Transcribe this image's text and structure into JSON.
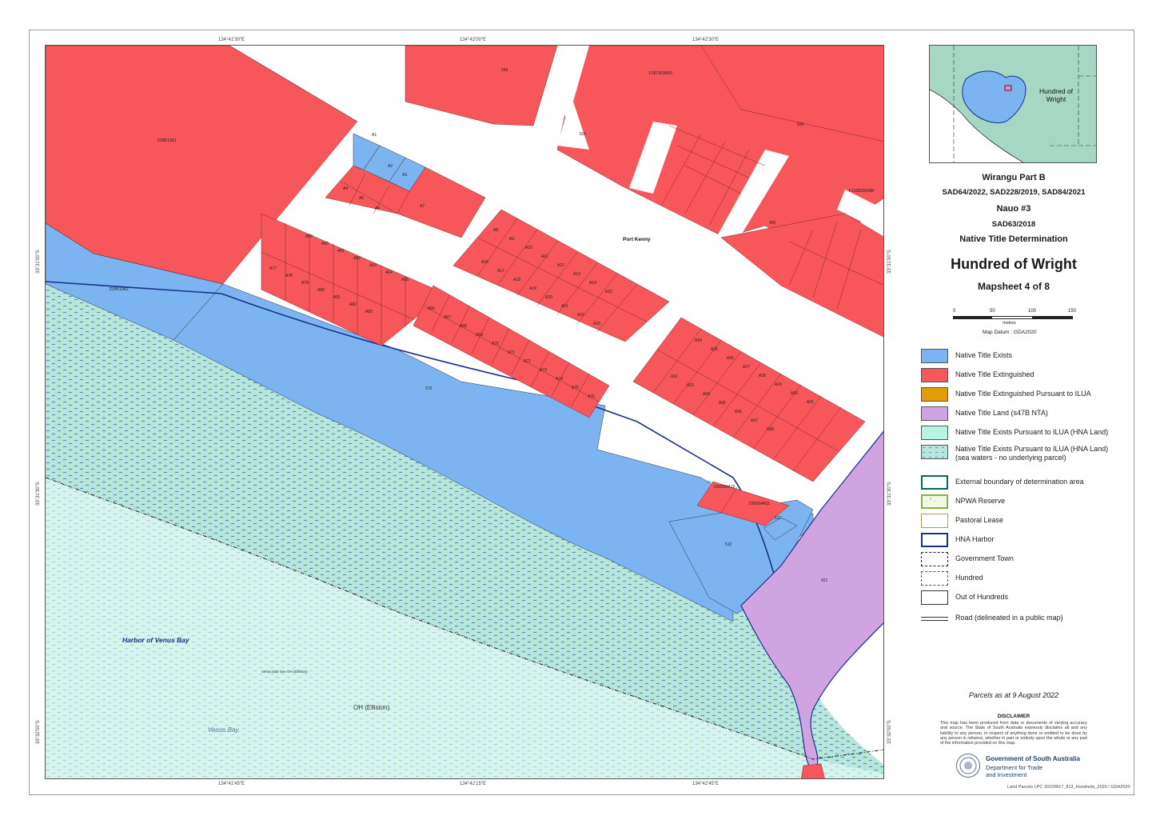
{
  "colors": {
    "native_title_exists": "#7cb4f2",
    "native_title_extinguished": "#f7575a",
    "native_title_extinguished_ilua": "#e49b00",
    "native_title_land_s47b": "#cfa4e0",
    "native_title_exists_ilua": "#b8f3e1",
    "sea_waters": "#b7e6da",
    "sea_waters_hatch": "#4d79b5",
    "road": "#ffffff",
    "hna_harbor_line": "#1c2f8c"
  },
  "map": {
    "place_port_kenny": "Port Kenny",
    "harbor_venus_bay": "Harbor of Venus Bay",
    "venus_bay": "Venus Bay",
    "oh_elliston": "OH (Elliston)",
    "sea_note": "Venus Bay See OH (Elliston)",
    "grid_top": [
      "134°41'30\"E",
      "134°42'00\"E",
      "134°42'30\"E"
    ],
    "grid_bottom": [
      "134°41'45\"E",
      "134°42'15\"E",
      "134°42'45\"E"
    ],
    "grid_left": [
      "33°31'00\"S",
      "33°31'30\"S",
      "33°32'00\"S"
    ],
    "grid_right": [
      "33°31'00\"S",
      "33°31'30\"S",
      "33°32'00\"S"
    ],
    "parcels": {
      "big_left": "D28513A1",
      "blue_left": "D28513A2",
      "top_mid": "243",
      "top_right_1": "F187953A50",
      "s500": "500",
      "s501": "501",
      "s450": "450",
      "s570": "570",
      "s512": "512",
      "s517": "517",
      "s421": "421",
      "f116": "F116820A288",
      "d5005": "D50054A10",
      "d5009": "D50054A11",
      "a1": "A1",
      "a2": "A2",
      "a3": "A3",
      "a4": "A4",
      "a5": "A5",
      "a6": "A6",
      "a7": "A7",
      "a_labels_block1": [
        "A59",
        "A60",
        "A61",
        "A62",
        "A63",
        "A64",
        "A65",
        "A77",
        "A78",
        "A79",
        "A80",
        "A81",
        "A82",
        "A83"
      ],
      "a_labels_block2": [
        "A8",
        "A9",
        "A10",
        "A11",
        "A12",
        "A13",
        "A14",
        "A15",
        "A16",
        "A17",
        "A18",
        "A19",
        "A20",
        "A21",
        "A22",
        "A23"
      ],
      "a_labels_block3": [
        "A66",
        "A67",
        "A68",
        "A69",
        "A70",
        "A71",
        "A72",
        "A73",
        "A74",
        "A75",
        "A76"
      ],
      "a_labels_block4": [
        "A24",
        "A25",
        "A26",
        "A27",
        "A28",
        "A29",
        "A30",
        "A31",
        "A32",
        "A33",
        "A34",
        "A35",
        "A36",
        "A37",
        "A38"
      ]
    }
  },
  "panel": {
    "locmap_label": "Hundred of Wright",
    "title_line1": "Wirangu Part B",
    "title_line2": "SAD64/2022, SAD228/2019, SAD84/2021",
    "title_line3": "Nauo #3",
    "title_line4": "SAD63/2018",
    "title_line5": "Native Title Determination",
    "main_title": "Hundred of Wright",
    "mapsheet": "Mapsheet 4 of 8",
    "scale_ticks": [
      "0",
      "50",
      "100",
      "150"
    ],
    "scale_unit": "metres",
    "datum": "Map Datum : GDA2020",
    "legend": [
      {
        "label": "Native Title Exists"
      },
      {
        "label": "Native Title Extinguished"
      },
      {
        "label": "Native Title Extinguished Pursuant to ILUA"
      },
      {
        "label": "Native Title Land (s47B NTA)"
      },
      {
        "label": "Native Title Exists Pursuant to ILUA (HNA Land)"
      },
      {
        "label": "Native Title Exists Pursuant to ILUA (HNA Land)",
        "label2": "(sea waters - no underlying parcel)"
      },
      {
        "label": "External boundary of determination area"
      },
      {
        "label": "NPWA Reserve"
      },
      {
        "label": "Pastoral Lease"
      },
      {
        "label": "HNA Harbor"
      },
      {
        "label": "Government Town"
      },
      {
        "label": "Hundred"
      },
      {
        "label": "Out of Hundreds"
      },
      {
        "label": "Road (delineated in a public map)"
      }
    ],
    "parcels_date": "Parcels as at 9 August 2022",
    "disclaimer_title": "DISCLAIMER",
    "disclaimer_text": "This map has been produced from data or documents of varying accuracy and source. The State of South Australia expressly disclaims all and any liability to any person, in respect of anything done or omitted to be done by any person in reliance, whether in part or entirely upon the whole or any part of the information provided on this map.",
    "gov_name": "Government of South Australia",
    "gov_dept_1": "Department for Trade",
    "gov_dept_2": "and Investment"
  },
  "footer_ref": "Land Parcels LPC 20220817_813_Hundreds_2020 / GDA2020"
}
